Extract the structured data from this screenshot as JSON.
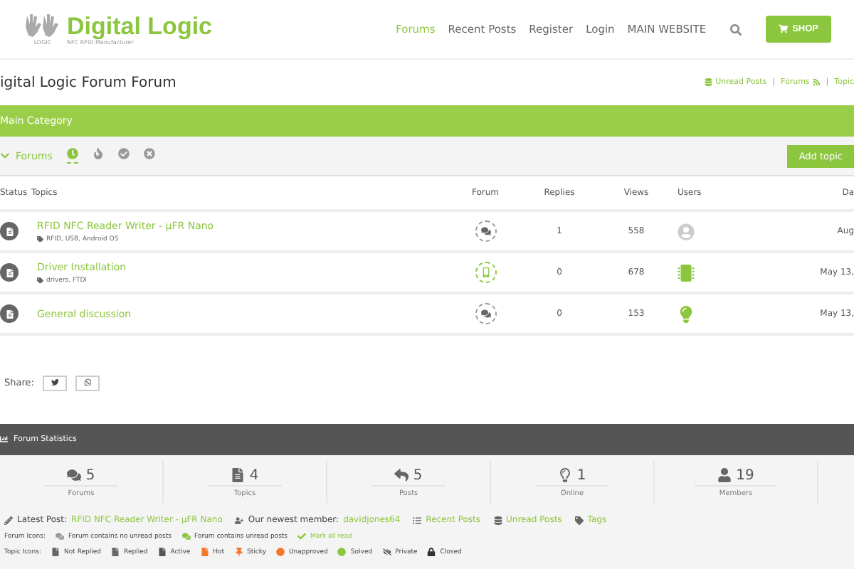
{
  "header": {
    "logo": {
      "name": "Digital Logic",
      "tagline": "NFC RFID Manufacturer",
      "badge": "LOGIC"
    },
    "nav": [
      {
        "label": "Forums",
        "selected": true
      },
      {
        "label": "Recent Posts",
        "selected": false
      },
      {
        "label": "Register",
        "selected": false
      },
      {
        "label": "Login",
        "selected": false
      },
      {
        "label": "MAIN WEBSITE",
        "selected": false
      }
    ],
    "shop_button": "SHOP"
  },
  "page_title": "igital Logic Forum Forum",
  "quick_links": [
    "Unread Posts",
    "Forums",
    "Topic"
  ],
  "quick_separator": "|",
  "category": "Main Category",
  "forum_bar": {
    "label": "Forums",
    "filters": [
      {
        "kind": "clock",
        "selected": true
      },
      {
        "kind": "fire",
        "selected": false
      },
      {
        "kind": "check",
        "selected": false
      },
      {
        "kind": "close",
        "selected": false
      }
    ],
    "add_button": "Add topic"
  },
  "table": {
    "columns": [
      "Status",
      "Topics",
      "Forum",
      "Replies",
      "Views",
      "Users",
      "Da"
    ],
    "rows": [
      {
        "title": "RFID NFC Reader Writer - µFR Nano",
        "tags": "RFID, USB, Android OS",
        "forum": {
          "kind": "chat"
        },
        "replies": "1",
        "views": "558",
        "users": {
          "kind": "people"
        },
        "date": "Aug"
      },
      {
        "title": "Driver Installation",
        "tags": "drivers, FTDI",
        "forum": {
          "kind": "device"
        },
        "replies": "0",
        "views": "678",
        "users": {
          "kind": "chip"
        },
        "date": "May 13,"
      },
      {
        "title": "General discussion",
        "forum": {
          "kind": "chat"
        },
        "replies": "0",
        "views": "153",
        "users": {
          "kind": "bulb"
        },
        "date": "May 13,"
      }
    ]
  },
  "share": {
    "label": "Share:",
    "buttons": [
      {
        "kind": "twitter"
      },
      {
        "kind": "whatsapp"
      }
    ]
  },
  "statistics": {
    "title": "Forum Statistics",
    "items": [
      {
        "kind": "forums",
        "value": "5",
        "label": "Forums"
      },
      {
        "kind": "topics",
        "value": "4",
        "label": "Topics"
      },
      {
        "kind": "posts",
        "value": "5",
        "label": "Posts"
      },
      {
        "kind": "online",
        "value": "1",
        "label": "Online"
      },
      {
        "kind": "members",
        "value": "19",
        "label": "Members"
      }
    ]
  },
  "info_line": {
    "latest_label": "Latest Post:",
    "latest_link": "RFID NFC Reader Writer - µFR Nano",
    "member_label": "Our newest member:",
    "member_link": "davidjones64",
    "links": [
      {
        "kind": "list",
        "label": "Recent Posts"
      },
      {
        "kind": "db",
        "label": "Unread Posts"
      },
      {
        "kind": "tag",
        "label": "Tags"
      }
    ]
  },
  "forum_icons": {
    "label": "Forum Icons:",
    "items": [
      {
        "label": "Forum contains no unread posts",
        "color": "#999999",
        "kind": "chat"
      },
      {
        "label": "Forum contains unread posts",
        "color": "#8cc63f",
        "kind": "chat"
      },
      {
        "label": "Mark all read",
        "color": "#8cc63f",
        "kind": "check"
      }
    ]
  },
  "topic_icons": {
    "label": "Topic Icons:",
    "items": [
      {
        "label": "Not Replied",
        "color": "#666666",
        "kind": "page"
      },
      {
        "label": "Replied",
        "color": "#666666",
        "kind": "page"
      },
      {
        "label": "Active",
        "color": "#555555",
        "kind": "page"
      },
      {
        "label": "Hot",
        "color": "#f5782a",
        "kind": "page"
      },
      {
        "label": "Sticky",
        "color": "#f5782a",
        "kind": "pin"
      },
      {
        "label": "Unapproved",
        "color": "#f5782a",
        "kind": "dot"
      },
      {
        "label": "Solved",
        "color": "#8cc63f",
        "kind": "dot"
      },
      {
        "label": "Private",
        "color": "#555555",
        "kind": "eye"
      },
      {
        "label": "Closed",
        "color": "#333333",
        "kind": "lock"
      }
    ]
  }
}
